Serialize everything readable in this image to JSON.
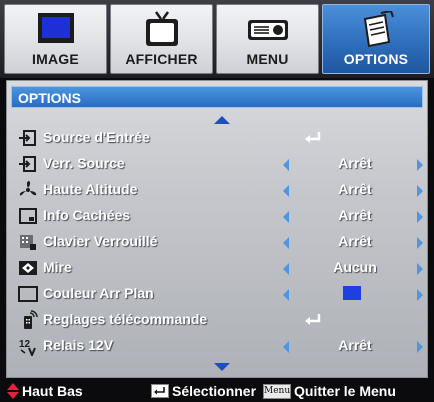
{
  "tabs": [
    {
      "label": "IMAGE",
      "icon": "monitor-icon",
      "active": false
    },
    {
      "label": "AFFICHER",
      "icon": "tv-icon",
      "active": false
    },
    {
      "label": "MENU",
      "icon": "projector-icon",
      "active": false
    },
    {
      "label": "OPTIONS",
      "icon": "notepad-icon",
      "active": true
    }
  ],
  "panel": {
    "title": "OPTIONS",
    "rows": [
      {
        "label": "Source d'Entrée",
        "icon": "input-source-icon",
        "type": "enter"
      },
      {
        "label": "Verr. Source",
        "icon": "source-lock-icon",
        "type": "select",
        "value": "Arrêt"
      },
      {
        "label": "Haute Altitude",
        "icon": "fan-icon",
        "type": "select",
        "value": "Arrêt"
      },
      {
        "label": "Info Cachées",
        "icon": "hidden-info-icon",
        "type": "select",
        "value": "Arrêt"
      },
      {
        "label": "Clavier Verrouillé",
        "icon": "keypad-lock-icon",
        "type": "select",
        "value": "Arrêt"
      },
      {
        "label": "Mire",
        "icon": "test-pattern-icon",
        "type": "select",
        "value": "Aucun"
      },
      {
        "label": "Couleur Arr Plan",
        "icon": "background-color-icon",
        "type": "color",
        "value_color": "#1f3fe0"
      },
      {
        "label": "Reglages télécommande",
        "icon": "remote-icon",
        "type": "enter"
      },
      {
        "label": "Relais 12V",
        "icon": "relay-12v-icon",
        "type": "select",
        "value": "Arrêt"
      }
    ]
  },
  "footer": {
    "nav_label": "Haut Bas",
    "select_label": "Sélectionner",
    "menu_key_label": "Menu",
    "quit_label": "Quitter le Menu"
  },
  "colors": {
    "accent": "#2f6fbc",
    "arrow": "#4f95e0",
    "nav_arrow": "#e0243a"
  }
}
